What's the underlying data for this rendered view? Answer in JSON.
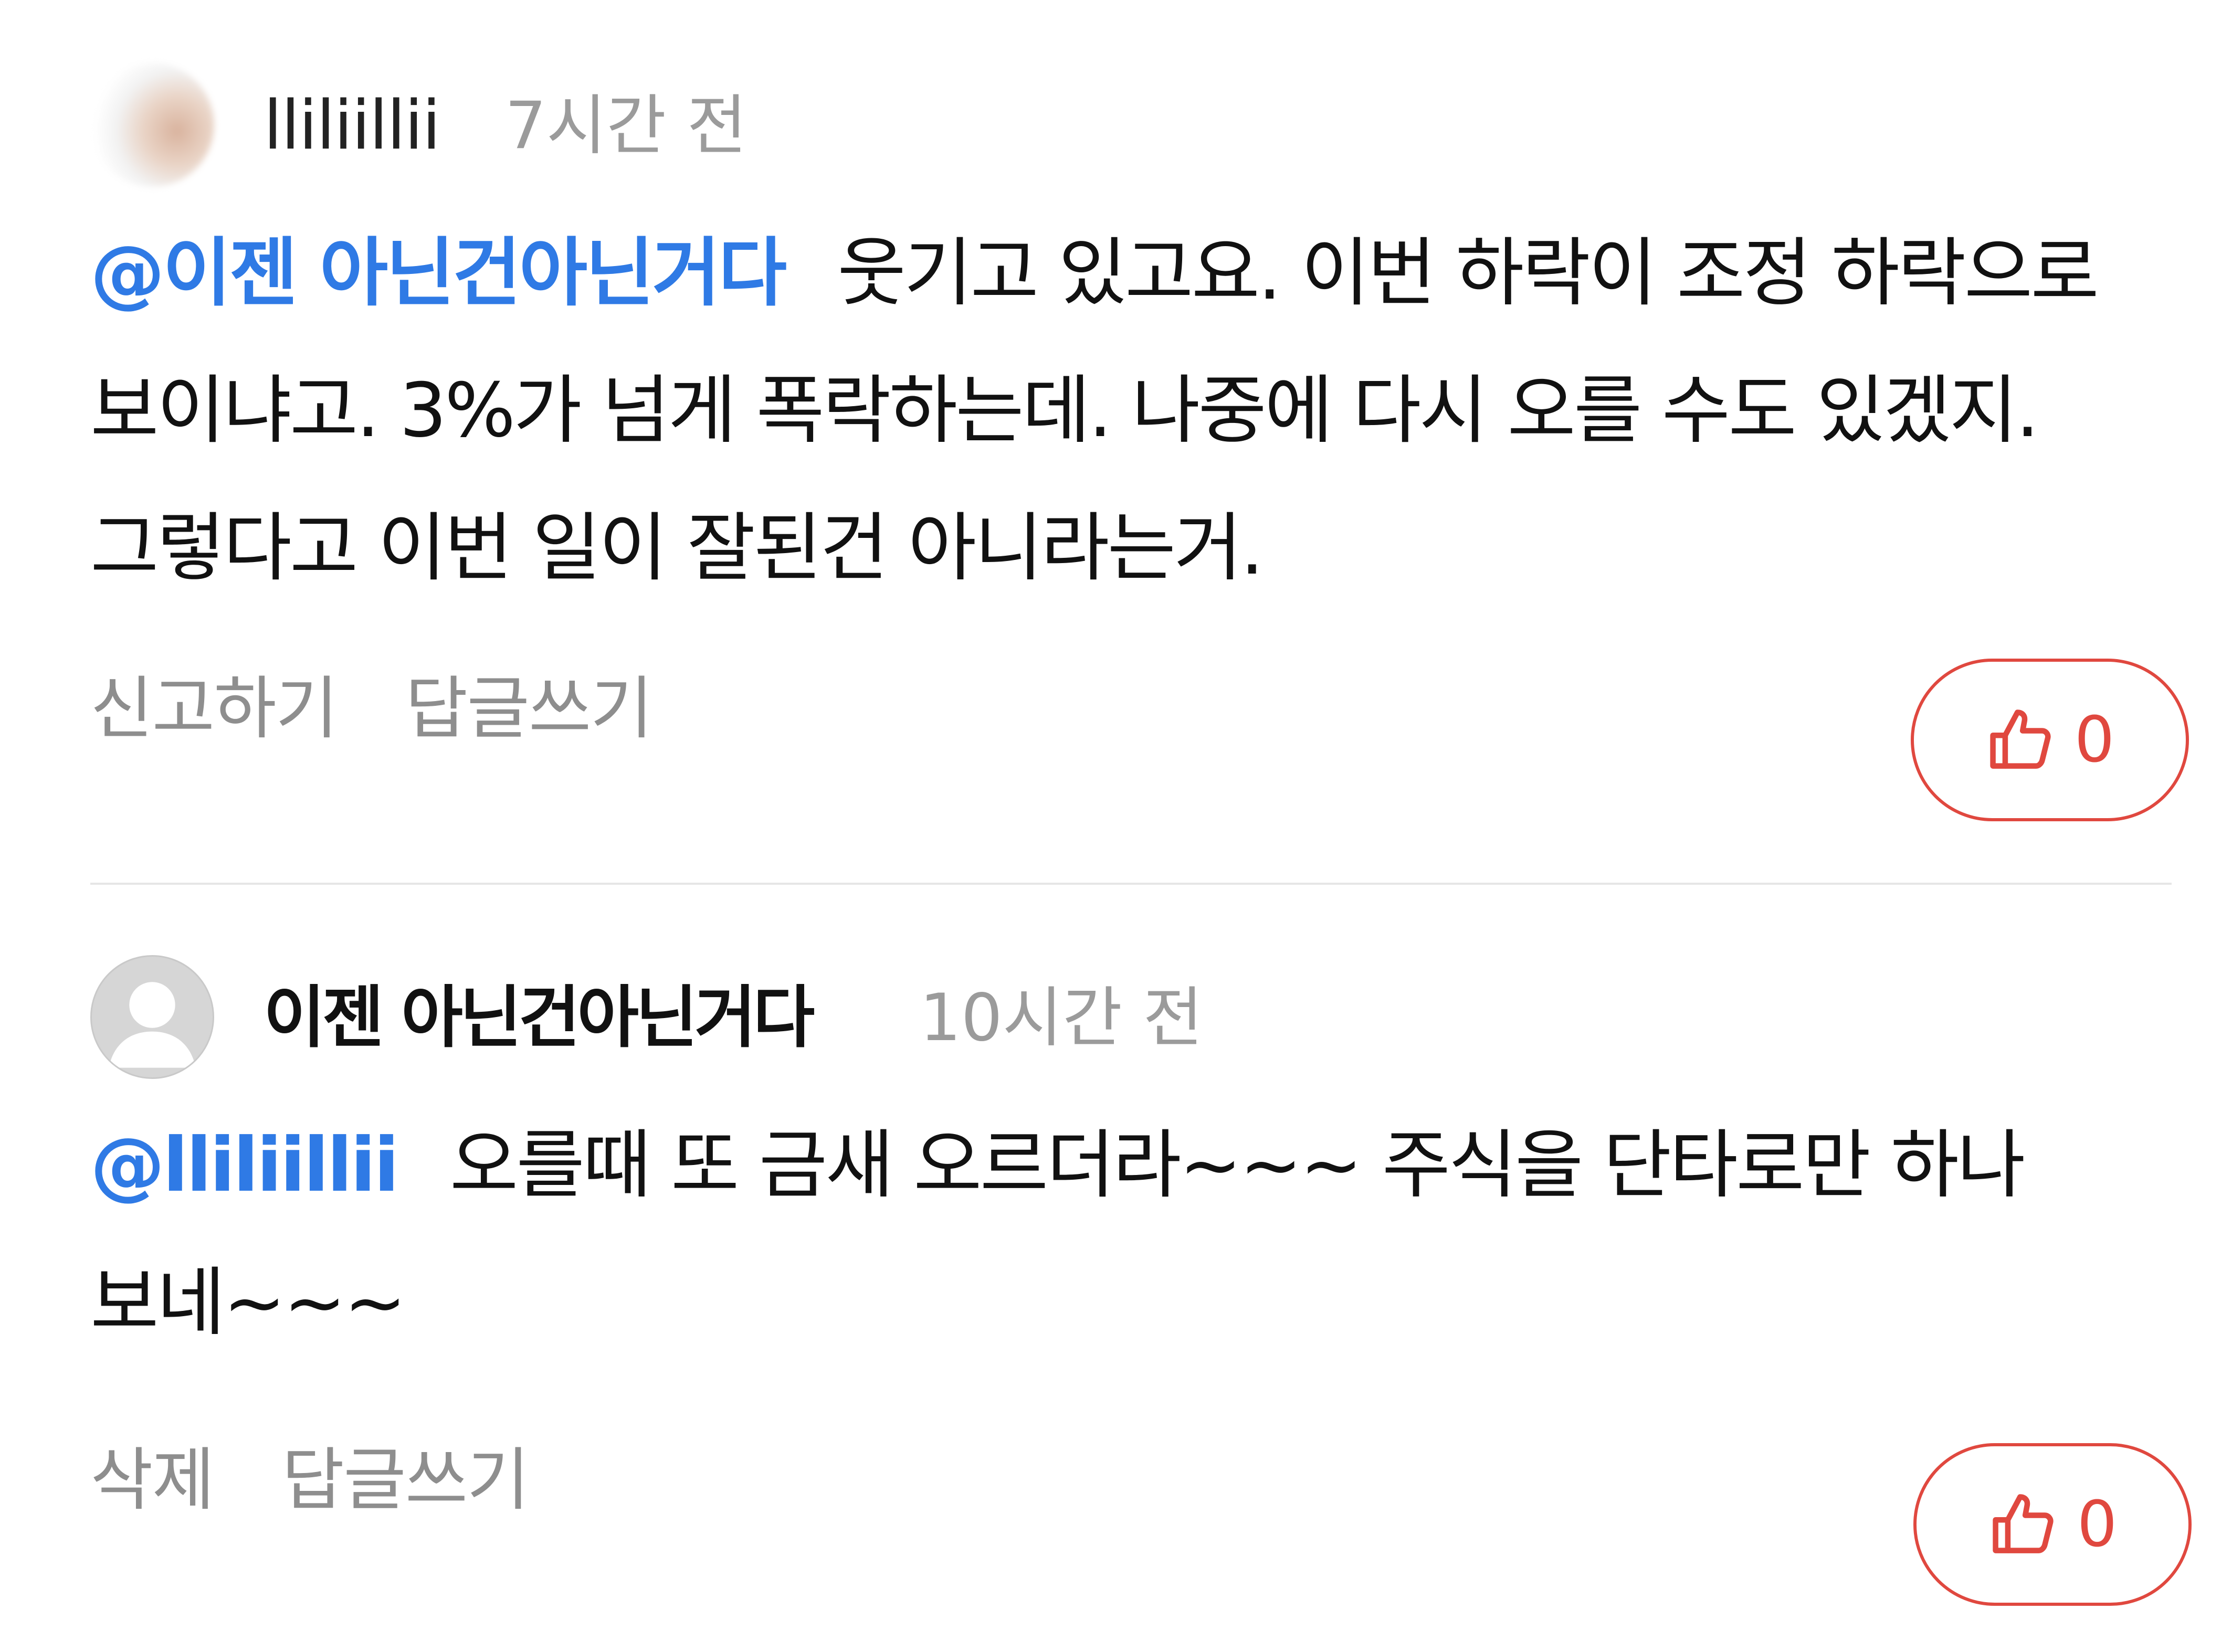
{
  "comments": [
    {
      "author": "lliliillii",
      "time": "7시간 전",
      "mention": "@이젠 아닌건아닌거다",
      "text": "웃기고 있고요. 이번 하락이 조정 하락으로 보이냐고. 3%가 넘게 폭락하는데. 나중에 다시 오를 수도 있겠지. 그렇다고 이번 일이 잘된건 아니라는거.",
      "action_1": "신고하기",
      "action_2": "답글쓰기",
      "likes": "0"
    },
    {
      "author": "이젠 아닌건아닌거다",
      "time": "10시간 전",
      "mention": "@lliliillii",
      "text": "오를때 또 금새 오르더라~~~ 주식을 단타로만 하나 보네~~~",
      "action_1": "삭제",
      "action_2": "답글쓰기",
      "likes": "0"
    }
  ],
  "icons": {
    "like": "thumbs-up-icon",
    "avatar_default": "default-user-icon"
  },
  "colors": {
    "mention": "#2f7ae5",
    "like_accent": "#e0483f",
    "muted_text": "#8e8e8e"
  }
}
